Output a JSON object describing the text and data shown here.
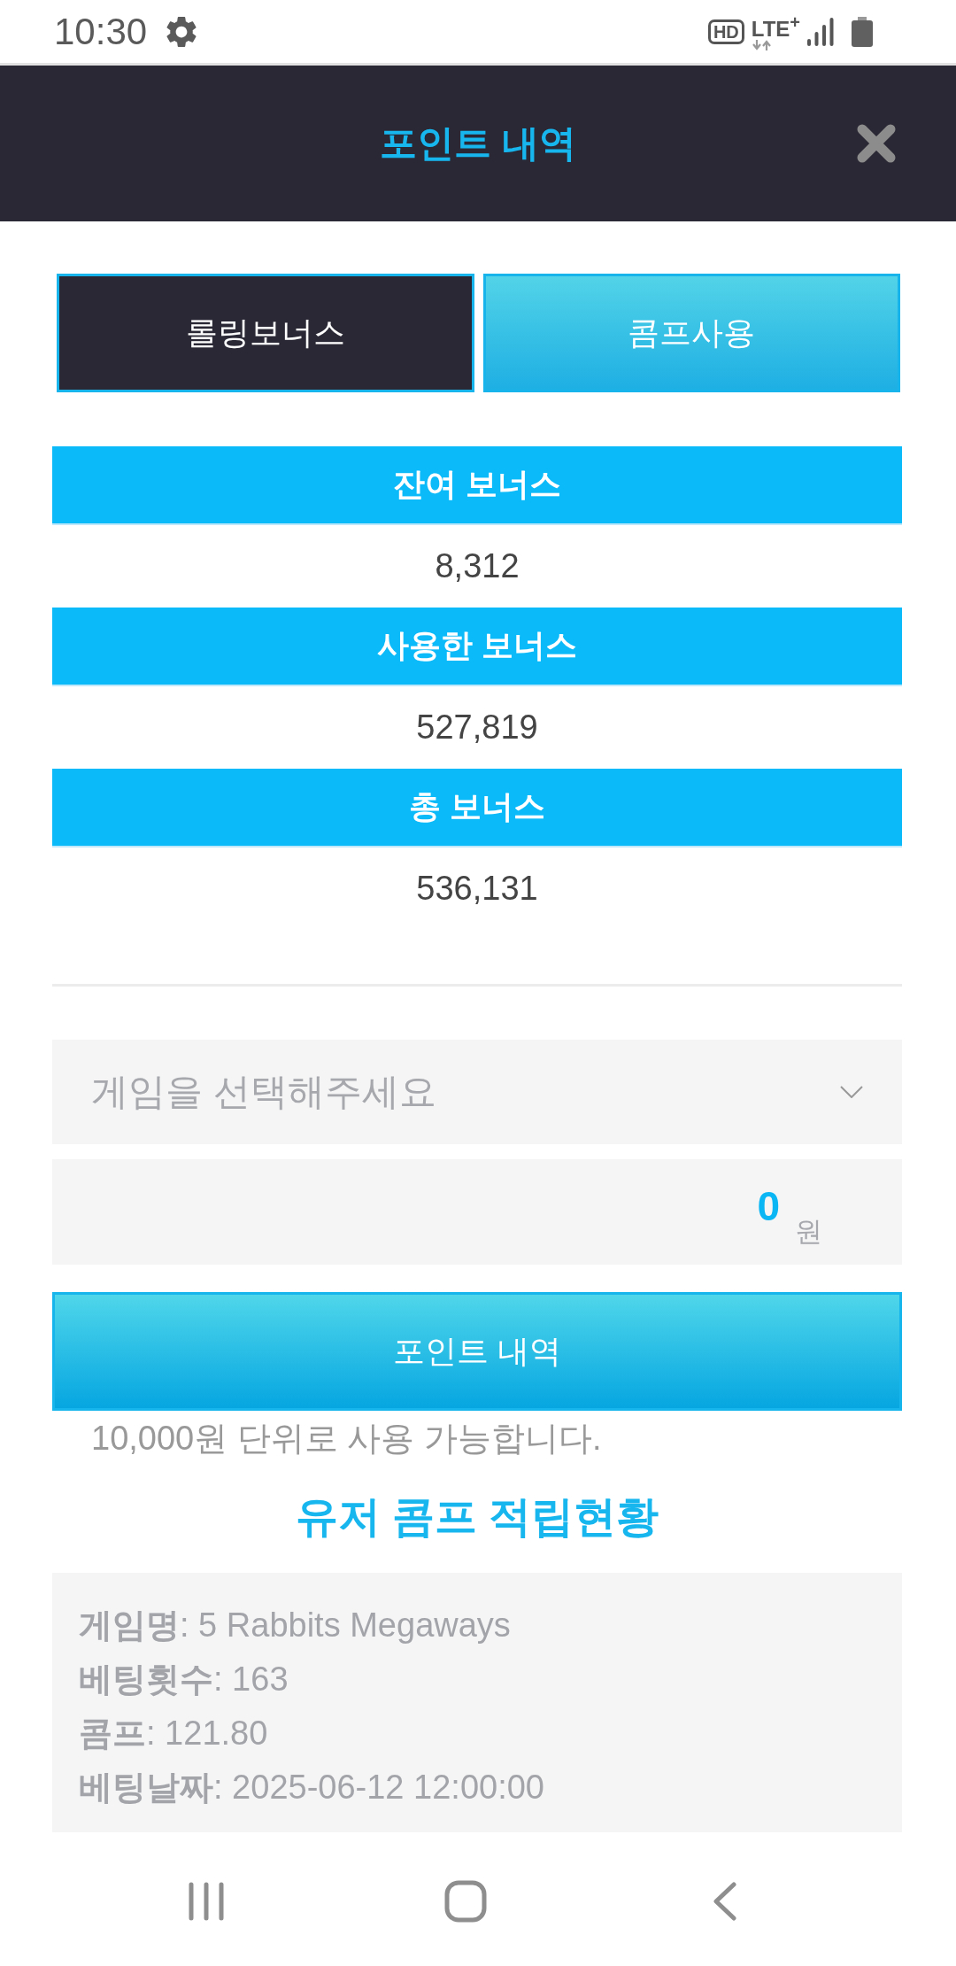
{
  "status_bar": {
    "time": "10:30",
    "hd": "HD",
    "network": "LTE$^{+}$"
  },
  "header": {
    "title": "포인트 내역"
  },
  "tabs": [
    {
      "label": "롤링보너스",
      "selected": true
    },
    {
      "label": "콤프사용",
      "selected": false
    }
  ],
  "summary": [
    {
      "label": "잔여 보너스",
      "value": "8,312"
    },
    {
      "label": "사용한 보너스",
      "value": "527,819"
    },
    {
      "label": "총 보너스",
      "value": "536,131"
    }
  ],
  "game_select": {
    "placeholder": "게임을 선택해주세요"
  },
  "amount": {
    "value": "0",
    "unit": "원"
  },
  "submit_button": {
    "label": "포인트 내역"
  },
  "note": "10,000원 단위로 사용 가능합니다.",
  "comp_status": {
    "title": "유저 콤프 적립현황",
    "lines": [
      "**게임명**: 5 Rabbits Megaways",
      "**베팅횟수**: 163",
      "**콤프**: 121.80",
      "**베팅날짜**: 2025-06-12 12:00:00"
    ]
  }
}
